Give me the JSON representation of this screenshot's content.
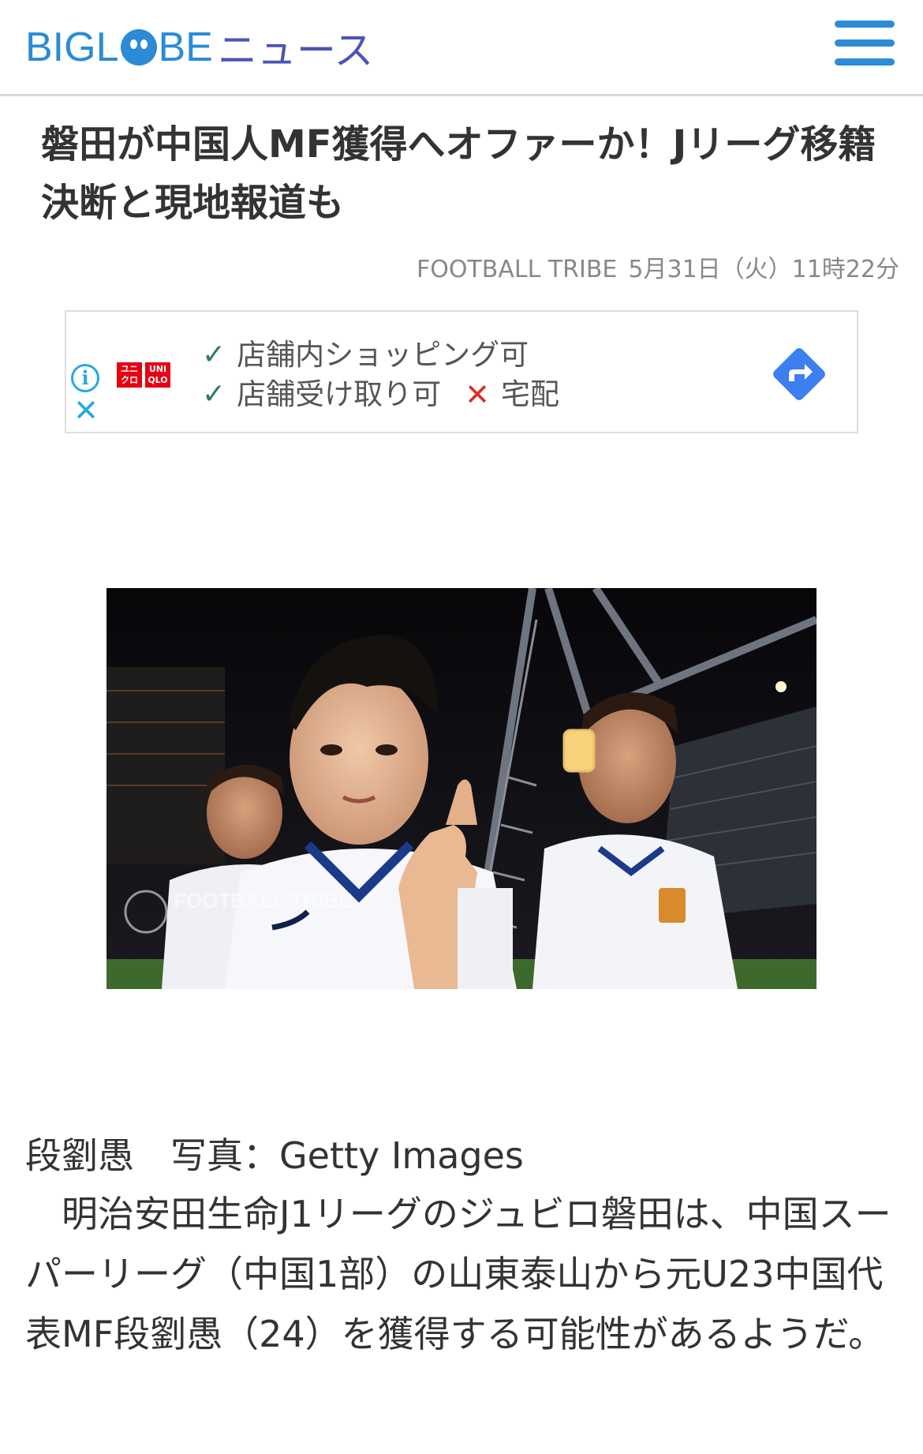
{
  "header": {
    "logo_brand_left": "BIGL",
    "logo_brand_right": "BE",
    "logo_news": "ニュース",
    "brand_color": "#2b8bd6",
    "news_color": "#4b55b5",
    "menu_icon": "hamburger-menu-icon"
  },
  "article": {
    "title": "磐田が中国人MF獲得へオファーか！Jリーグ移籍決断と現地報道も",
    "source": "FOOTBALL TRIBE",
    "date": "5月31日（火）11時22分",
    "photo_caption": "段劉愚　写真：Getty Images",
    "body": "　明治安田生命J1リーグのジュビロ磐田は、中国スーパーリーグ（中国1部）の山東泰山から元U23中国代表MF段劉愚（24）を獲得する可能性があるようだ。"
  },
  "ad": {
    "brand_logo_top": [
      "UNI",
      "QLO"
    ],
    "line1": "店舗内ショッピング可",
    "line2": "店舗受け取り可",
    "line3": "宅配",
    "check_icon": "check-icon",
    "cross_icon": "cross-icon",
    "info_icon": "info-icon",
    "close_icon": "close-icon",
    "arrow_icon": "directions-arrow-icon",
    "check_color": "#2e7d5b",
    "cross_color": "#d93025",
    "arrow_color": "#3b7ff0"
  },
  "photo": {
    "watermark": "FOOTBALL TRIBE"
  }
}
